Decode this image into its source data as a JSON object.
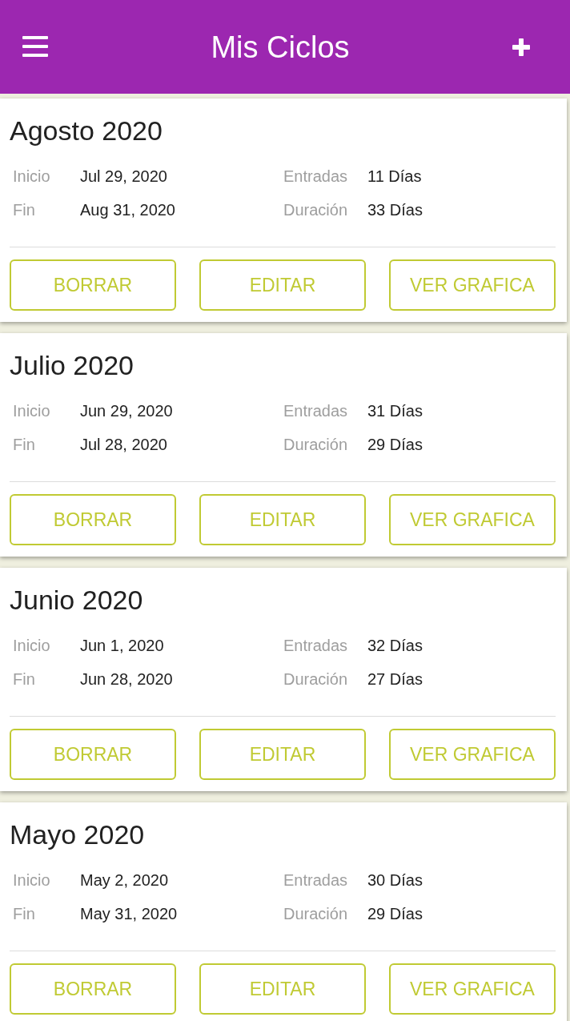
{
  "app_bar": {
    "title": "Mis Ciclos"
  },
  "cycles": [
    {
      "title": "Agosto 2020",
      "fields": [
        {
          "label": "Inicio",
          "value": "Jul 29, 2020"
        },
        {
          "label": "Entradas",
          "value": "11 Días"
        },
        {
          "label": "Fin",
          "value": "Aug 31, 2020"
        },
        {
          "label": "Duración",
          "value": "33 Días"
        }
      ],
      "buttons": [
        "BORRAR",
        "EDITAR",
        "VER GRAFICA"
      ]
    },
    {
      "title": "Julio 2020",
      "fields": [
        {
          "label": "Inicio",
          "value": "Jun 29, 2020"
        },
        {
          "label": "Entradas",
          "value": "31 Días"
        },
        {
          "label": "Fin",
          "value": "Jul 28, 2020"
        },
        {
          "label": "Duración",
          "value": "29 Días"
        }
      ],
      "buttons": [
        "BORRAR",
        "EDITAR",
        "VER GRAFICA"
      ]
    },
    {
      "title": "Junio 2020",
      "fields": [
        {
          "label": "Inicio",
          "value": "Jun 1, 2020"
        },
        {
          "label": "Entradas",
          "value": "32 Días"
        },
        {
          "label": "Fin",
          "value": "Jun 28, 2020"
        },
        {
          "label": "Duración",
          "value": "27 Días"
        }
      ],
      "buttons": [
        "BORRAR",
        "EDITAR",
        "VER GRAFICA"
      ]
    },
    {
      "title": "Mayo 2020",
      "fields": [
        {
          "label": "Inicio",
          "value": "May 2, 2020"
        },
        {
          "label": "Entradas",
          "value": "30 Días"
        },
        {
          "label": "Fin",
          "value": "May 31, 2020"
        },
        {
          "label": "Duración",
          "value": "29 Días"
        }
      ],
      "buttons": [
        "BORRAR",
        "EDITAR",
        "VER GRAFICA"
      ]
    }
  ]
}
